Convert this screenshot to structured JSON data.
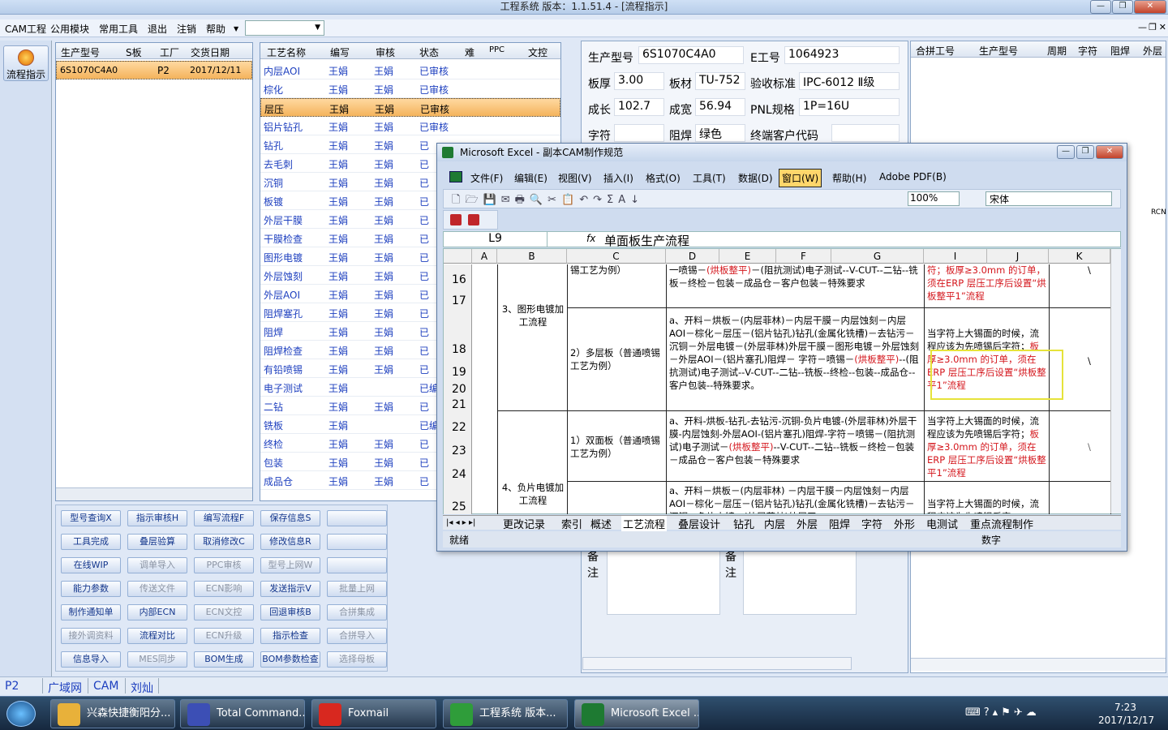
{
  "app": {
    "title": "工程系统   版本：1.1.51.4 - [流程指示]",
    "menus": [
      "CAM工程",
      "公用模块",
      "常用工具",
      "退出",
      "注销",
      "帮助"
    ]
  },
  "left": {
    "flow_button": "流程指示"
  },
  "orders": {
    "headers": [
      "生产型号",
      "S板",
      "工厂",
      "交货日期"
    ],
    "row": [
      "6S1070C4A0",
      "",
      "P2",
      "2017/12/11"
    ]
  },
  "process": {
    "headers": [
      "工艺名称",
      "编写",
      "审核",
      "状态",
      "难",
      "PPC",
      "文控"
    ],
    "rows": [
      [
        "内层AOI",
        "王娟",
        "王娟",
        "已审核"
      ],
      [
        "棕化",
        "王娟",
        "王娟",
        "已审核"
      ],
      [
        "层压",
        "王娟",
        "王娟",
        "已审核"
      ],
      [
        "铝片钻孔",
        "王娟",
        "王娟",
        "已审核"
      ],
      [
        "钻孔",
        "王娟",
        "王娟",
        "已"
      ],
      [
        "去毛刺",
        "王娟",
        "王娟",
        "已"
      ],
      [
        "沉铜",
        "王娟",
        "王娟",
        "已"
      ],
      [
        "板镀",
        "王娟",
        "王娟",
        "已"
      ],
      [
        "外层干膜",
        "王娟",
        "王娟",
        "已"
      ],
      [
        "干膜检查",
        "王娟",
        "王娟",
        "已"
      ],
      [
        "图形电镀",
        "王娟",
        "王娟",
        "已"
      ],
      [
        "外层蚀刻",
        "王娟",
        "王娟",
        "已"
      ],
      [
        "外层AOI",
        "王娟",
        "王娟",
        "已"
      ],
      [
        "阻焊塞孔",
        "王娟",
        "王娟",
        "已"
      ],
      [
        "阻焊",
        "王娟",
        "王娟",
        "已"
      ],
      [
        "阻焊检查",
        "王娟",
        "王娟",
        "已"
      ],
      [
        "有铅喷锡",
        "王娟",
        "王娟",
        "已"
      ],
      [
        "电子测试",
        "王娟",
        "",
        "已编"
      ],
      [
        "二钻",
        "王娟",
        "王娟",
        "已"
      ],
      [
        "铣板",
        "王娟",
        "",
        "已编"
      ],
      [
        "终检",
        "王娟",
        "王娟",
        "已"
      ],
      [
        "包装",
        "王娟",
        "王娟",
        "已"
      ],
      [
        "成品仓",
        "王娟",
        "王娟",
        "已"
      ]
    ]
  },
  "buttons": [
    [
      "型号查询X",
      "指示审核H",
      "编写流程F",
      "保存信息S",
      ""
    ],
    [
      "工具完成",
      "叠层验算",
      "取消修改C",
      "修改信息R",
      ""
    ],
    [
      "在线WIP",
      "调单导入",
      "PPC审核",
      "型号上网W",
      ""
    ],
    [
      "能力参数",
      "传送文件",
      "ECN影响",
      "发送指示V",
      "批量上网"
    ],
    [
      "制作通知单",
      "内部ECN",
      "ECN文控",
      "回退审核B",
      "合拼集成"
    ],
    [
      "接外调资料",
      "流程对比",
      "ECN升级",
      "指示检查",
      "合拼导入"
    ],
    [
      "信息导入",
      "MES同步",
      "BOM生成",
      "BOM参数检查",
      "选择母板"
    ]
  ],
  "info": {
    "model_label": "生产型号",
    "model": "6S1070C4A0",
    "e_label": "E工号",
    "e_no": "1064923",
    "thick_label": "板厚",
    "thick": "3.00",
    "mat_label": "板材",
    "mat": "TU-752",
    "std_label": "验收标准",
    "std": "IPC-6012 Ⅱ级",
    "len_label": "成长",
    "len": "102.7",
    "wid_label": "成宽",
    "wid": "56.94",
    "pnl_label": "PNL规格",
    "pnl": "1P=16U",
    "char_label": "字符",
    "mask_label": "阻焊",
    "mask": "绿色",
    "cust_label": "终端客户代码"
  },
  "right": {
    "headers": [
      "合拼工号",
      "生产型号",
      "周期",
      "字符",
      "阻焊",
      "外层"
    ],
    "rcn": "RCN"
  },
  "notes": {
    "label1": "备",
    "label2": "注"
  },
  "status": {
    "items": [
      "P2",
      "广域网",
      "CAM",
      "刘灿"
    ]
  },
  "excel": {
    "title": "Microsoft Excel - 副本CAM制作规范",
    "menus": [
      "文件(F)",
      "编辑(E)",
      "视图(V)",
      "插入(I)",
      "格式(O)",
      "工具(T)",
      "数据(D)",
      "窗口(W)",
      "帮助(H)",
      "Adobe PDF(B)"
    ],
    "zoom": "100%",
    "font": "宋体",
    "cellref": "L9",
    "formula": "单面板生产流程",
    "cols": [
      "A",
      "B",
      "C",
      "D",
      "E",
      "F",
      "G",
      "I",
      "J",
      "K"
    ],
    "rownums": [
      "16",
      "17",
      "18",
      "19",
      "20",
      "21",
      "22",
      "23",
      "24",
      "25"
    ],
    "b1": "3、图形电镀加工流程",
    "b2": "4、负片电镀加工流程",
    "c1": "锡工艺为例）",
    "c2": "2）多层板（普通喷锡工艺为例）",
    "c3": "1）双面板（普通喷锡工艺为例）",
    "d1a": "一喷锡－",
    "d1b": "(烘板整平)",
    "d1c": "－(阻抗测试)电子测试--V-CUT--二钻--铣板－终检－包装－成品仓－客户包装－特殊要求",
    "d2a": "a、开料－烘板－(内层菲林)－内层干膜－内层蚀刻－内层AOI－棕化－层压－(铝片钻孔)钻孔(金属化铣槽)－去钻污－沉铜－外层电镀－(外层菲林)外层干膜－图形电镀－外层蚀刻－外层AOI－(铝片塞孔)阻焊－ 字符－喷锡－",
    "d2b": "(烘板整平)",
    "d2c": "--(阻抗测试)电子测试--V-CUT--二钻--铣板--终检--包装--成品仓--客户包装--特殊要求。",
    "d3a": "a、开料-烘板-钻孔-去钻污-沉铜-负片电镀-(外层菲林)外层干膜-内层蚀刻-外层AOI-(铝片塞孔)阻焊-字符－喷锡－(阻抗测试)电子测试－",
    "d3b": "(烘板整平)",
    "d3c": "--V-CUT--二钻--铣板－终检－包装－成品仓－客户包装－特殊要求",
    "d4": "a、开料－烘板－(内层菲林) －内层干膜－内层蚀刻－内层AOI－棕化－层压－(铝片钻孔)钻孔(金属化铣槽)－去钻污－沉铜－负片电镀－(外层菲林)外层干",
    "i1a": "符；板厚≥3.0mm 的订",
    "i1b": "单，须在ERP 层压工序后设置“烘板整平1”流程",
    "i2a": "当字符上大锡面的时候，流程应该为先喷锡后字符；",
    "i2b": "板厚≥3.0mm 的订单，须在ERP 层压工序后设置“烘板整平1”流程",
    "i3a": "当字符上大锡面的时候，流程应该为先喷锡后字符；",
    "i3b": "板厚≥3.0mm 的订单，须在ERP 层压工序后设置“烘板整平1”流程",
    "i4a": "当字符上大锡面的时候，流程应该为先喷锡后字",
    "k": "\\",
    "sheets": [
      "更改记录",
      "索引",
      "概述",
      "工艺流程",
      "叠层设计",
      "钻孔",
      "内层",
      "外层",
      "阻焊",
      "字符",
      "外形",
      "电测试",
      "重点流程制作"
    ],
    "ready": "就绪",
    "numlock": "数字"
  },
  "taskbar": {
    "items": [
      "兴森快捷衡阳分...",
      "Total Command...",
      "Foxmail",
      "工程系统  版本...",
      "Microsoft Excel ..."
    ],
    "time": "7:23",
    "date": "2017/12/17"
  }
}
